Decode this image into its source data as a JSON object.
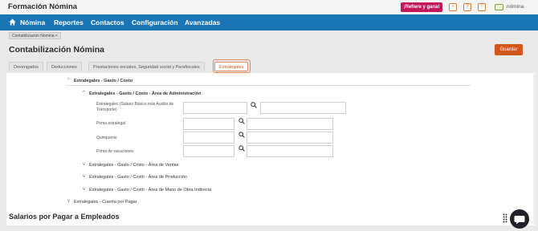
{
  "app": {
    "title": "Formación Nómina"
  },
  "topbar": {
    "refer_label": "¡Refiere y gana!",
    "icons": [
      "plus-icon",
      "help-icon",
      "notification-icon"
    ],
    "user_name": "nómina"
  },
  "nav": {
    "items": [
      "Nómina",
      "Reportes",
      "Contactos",
      "Configuración",
      "Avanzadas"
    ]
  },
  "breadcrumb": {
    "chip_label": "Contabilización Nómina ×"
  },
  "page": {
    "title": "Contabilización Nómina",
    "save_label": "Guardar"
  },
  "tabs": [
    {
      "label": "Devengados",
      "active": false
    },
    {
      "label": "Deducciones",
      "active": false
    },
    {
      "label": "Prestaciones sociales, Seguridad social y Parafiscales",
      "active": false
    },
    {
      "label": "Extralegales",
      "active": true
    }
  ],
  "tree": {
    "root": "Extralegales - Gasto / Costo",
    "admin_section": "Extralegales - Gasto / Costo - Área de Administración",
    "fields": [
      {
        "label": "Extralegales (Salario Básico más Auxilio de Transporte)"
      },
      {
        "label": "Prima extralegal"
      },
      {
        "label": "Quinquenio"
      },
      {
        "label": "Prima de vacaciones"
      }
    ],
    "collapsed_sections": [
      "Extralegales - Gasto / Costo - Área de Ventas",
      "Extralegales - Gasto / Costo - Área de Producción",
      "Extralegales - Gasto / Costo - Área de Mano de Obra Indirecta"
    ],
    "payable": "Extralegales - Cuenta por Pagar"
  },
  "section2": {
    "title": "Salarios por Pagar a Empleados"
  },
  "colors": {
    "nav": "#1a75b4",
    "accent": "#d2571b",
    "refer": "#c2185b"
  }
}
